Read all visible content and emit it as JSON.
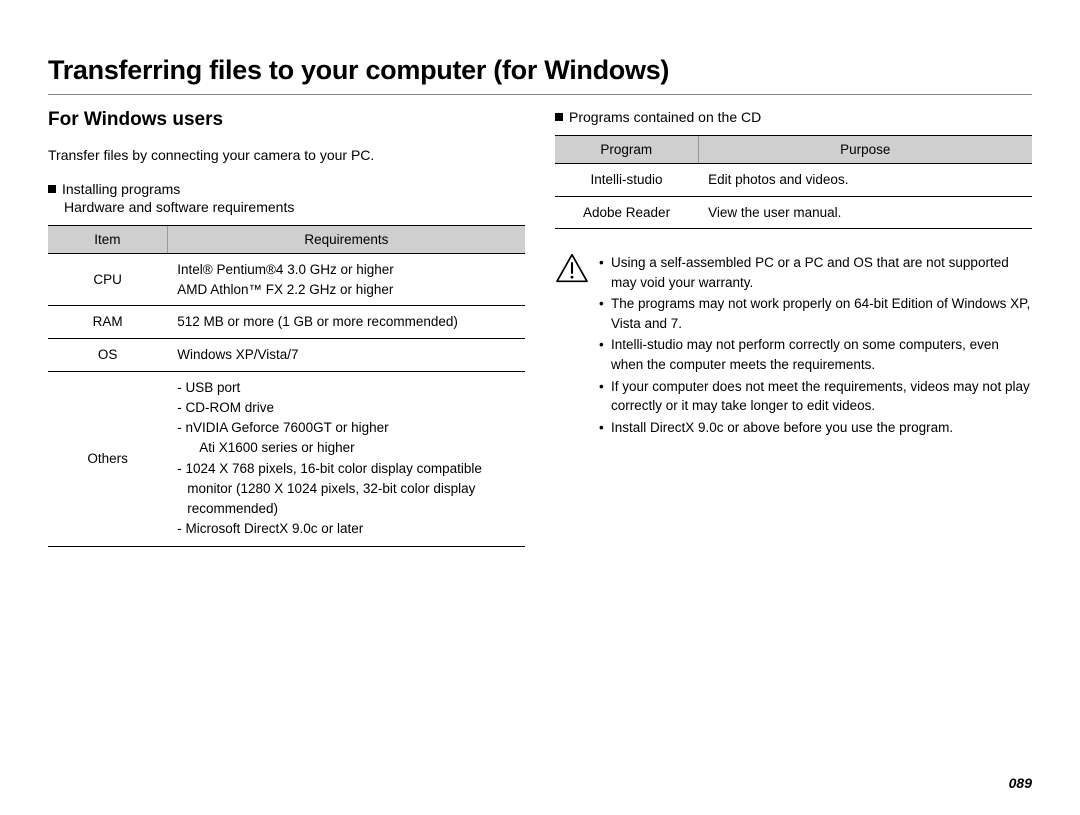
{
  "title": "Transferring files to your computer (for Windows)",
  "leftColumn": {
    "heading": "For Windows users",
    "intro": "Transfer files by connecting your camera to your PC.",
    "installingLabel": "Installing programs",
    "requirementsLabel": "Hardware and software requirements",
    "reqTable": {
      "headers": {
        "item": "Item",
        "req": "Requirements"
      },
      "rows": [
        {
          "item": "CPU",
          "req": "Intel® Pentium®4 3.0 GHz or higher\nAMD Athlon™ FX 2.2 GHz or higher"
        },
        {
          "item": "RAM",
          "req": "512 MB or more (1 GB or more recommended)"
        },
        {
          "item": "OS",
          "req": "Windows XP/Vista/7"
        },
        {
          "item": "Others",
          "req_list": [
            "- USB port",
            "- CD-ROM drive",
            "- nVIDIA Geforce 7600GT or higher",
            "  Ati X1600 series or higher",
            "- 1024 X 768 pixels, 16-bit color display compatible monitor (1280 X 1024 pixels, 32-bit color display recommended)",
            "- Microsoft DirectX 9.0c or later"
          ]
        }
      ]
    }
  },
  "rightColumn": {
    "programsLabel": "Programs contained on the CD",
    "progTable": {
      "headers": {
        "program": "Program",
        "purpose": "Purpose"
      },
      "rows": [
        {
          "program": "Intelli-studio",
          "purpose": "Edit photos and videos."
        },
        {
          "program": "Adobe Reader",
          "purpose": "View the user manual."
        }
      ]
    },
    "warnings": [
      "Using a self-assembled PC or a PC and OS that are not supported may void your warranty.",
      "The programs may not work properly on 64-bit Edition of Windows XP, Vista and 7.",
      "Intelli-studio may not perform correctly on some computers, even when the computer meets the requirements.",
      "If your computer does not meet the requirements, videos may not play correctly or it may take longer to edit videos.",
      "Install DirectX 9.0c or above before you use the program."
    ]
  },
  "pageNumber": "089"
}
